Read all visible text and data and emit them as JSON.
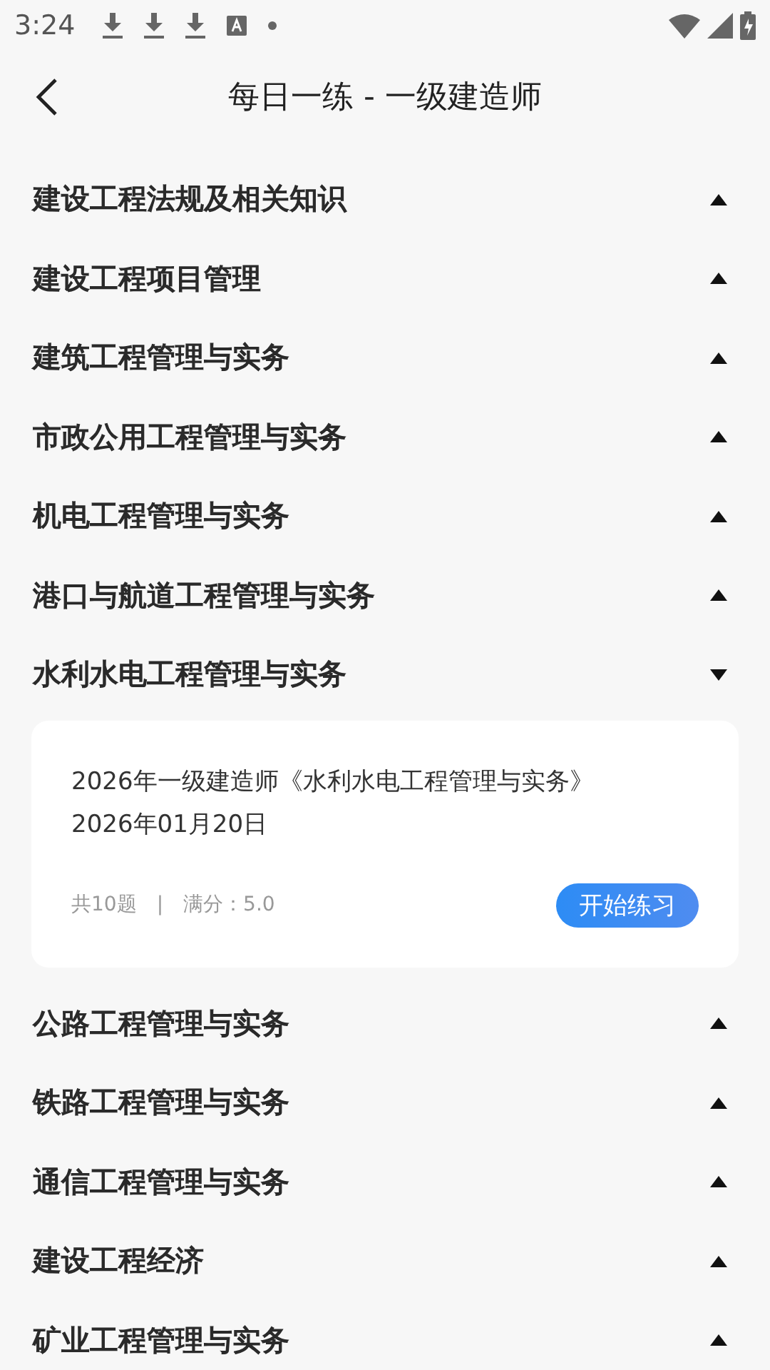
{
  "status_bar": {
    "time": "3:24"
  },
  "header": {
    "title": "每日一练 - 一级建造师"
  },
  "sections": [
    {
      "title": "建设工程法规及相关知识",
      "expanded": false
    },
    {
      "title": "建设工程项目管理",
      "expanded": false
    },
    {
      "title": "建筑工程管理与实务",
      "expanded": false
    },
    {
      "title": "市政公用工程管理与实务",
      "expanded": false
    },
    {
      "title": "机电工程管理与实务",
      "expanded": false
    },
    {
      "title": "港口与航道工程管理与实务",
      "expanded": false
    },
    {
      "title": "水利水电工程管理与实务",
      "expanded": true,
      "exercises": [
        {
          "name": "2026年一级建造师《水利水电工程管理与实务》",
          "date": "2026年01月20日",
          "count": "共10题",
          "separator": "|",
          "score": "满分：5.0",
          "button": "开始练习"
        }
      ]
    },
    {
      "title": "公路工程管理与实务",
      "expanded": false
    },
    {
      "title": "铁路工程管理与实务",
      "expanded": false
    },
    {
      "title": "通信工程管理与实务",
      "expanded": false
    },
    {
      "title": "建设工程经济",
      "expanded": false
    },
    {
      "title": "矿业工程管理与实务",
      "expanded": false
    }
  ]
}
